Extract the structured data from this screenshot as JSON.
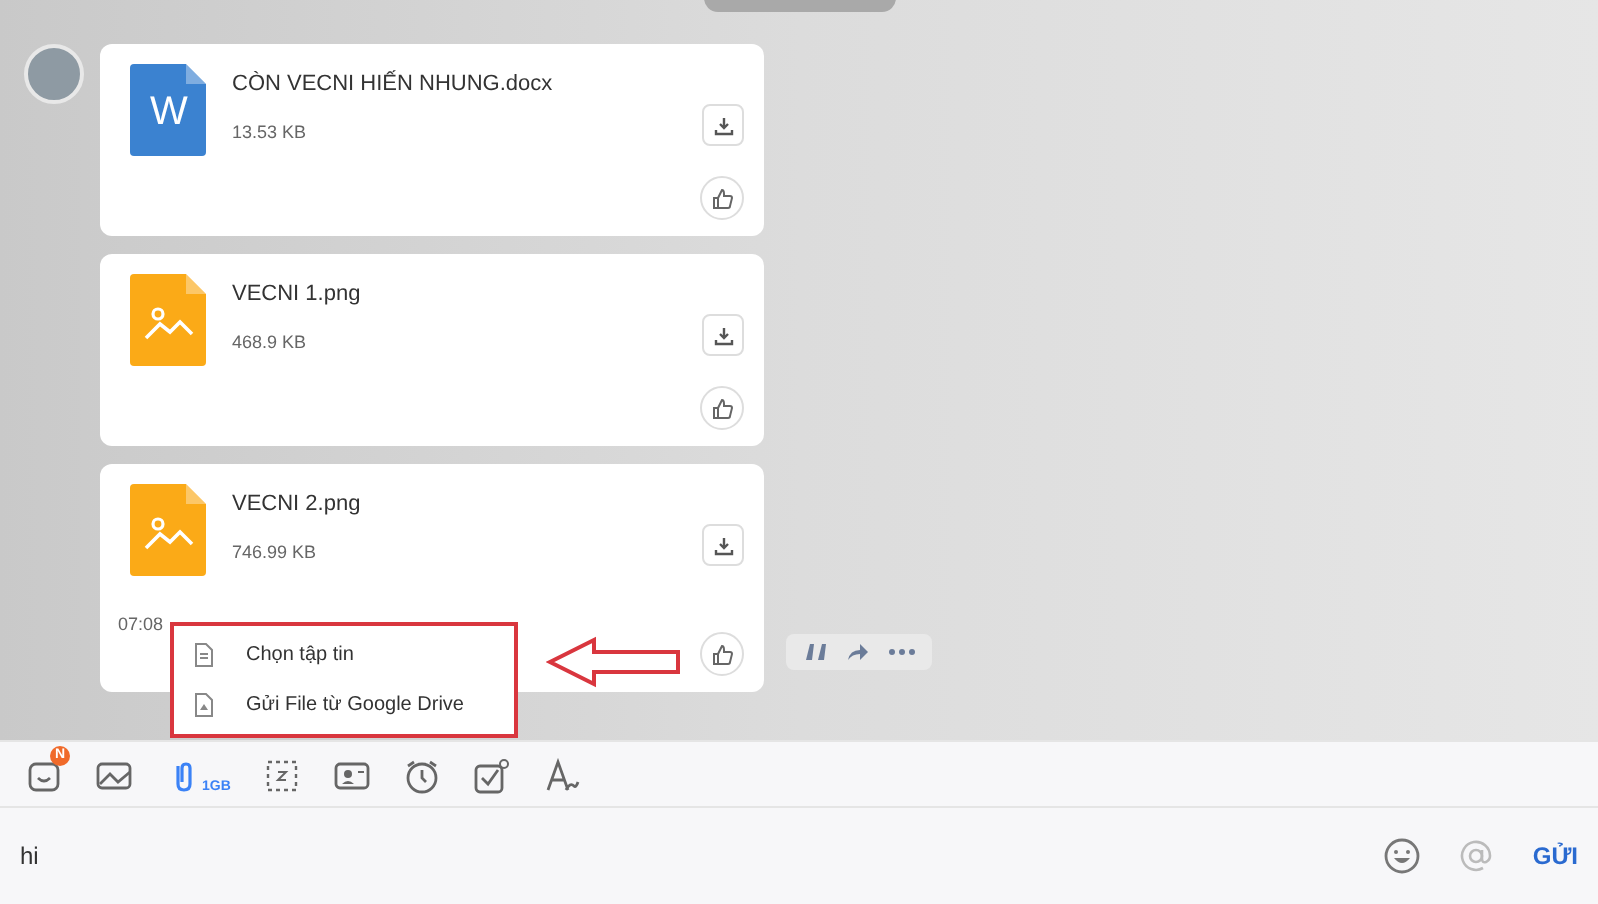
{
  "messages": [
    {
      "kind": "word",
      "name": "CÒN VECNI HIẾN NHUNG.docx",
      "size": "13.53 KB",
      "icon_letter": "W"
    },
    {
      "kind": "image",
      "name": "VECNI 1.png",
      "size": "468.9 KB"
    },
    {
      "kind": "image",
      "name": "VECNI 2.png",
      "size": "746.99 KB",
      "time": "07:08"
    }
  ],
  "attach_menu": {
    "items": [
      {
        "kind": "file",
        "label": "Chọn tập tin"
      },
      {
        "kind": "drive",
        "label": "Gửi File từ Google Drive"
      }
    ]
  },
  "toolbar": [
    {
      "kind": "sticker",
      "badge": "N",
      "selected": false
    },
    {
      "kind": "image",
      "selected": false
    },
    {
      "kind": "attach",
      "label": "1GB",
      "selected": true
    },
    {
      "kind": "capture",
      "selected": false
    },
    {
      "kind": "contact",
      "selected": false
    },
    {
      "kind": "reminder",
      "selected": false
    },
    {
      "kind": "task",
      "selected": false
    },
    {
      "kind": "format",
      "selected": false
    }
  ],
  "composer": {
    "value": "hi",
    "send": "GỬI"
  }
}
